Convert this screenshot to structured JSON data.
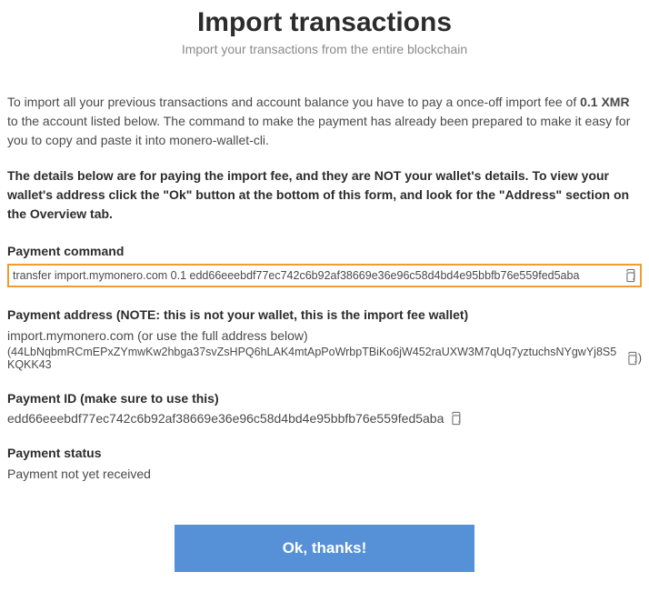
{
  "header": {
    "title": "Import transactions",
    "subtitle": "Import your transactions from the entire blockchain"
  },
  "intro": {
    "part1": "To import all your previous transactions and account balance you have to pay a once-off import fee of ",
    "fee": "0.1 XMR",
    "part2": " to the account listed below. The command to make the payment has already been prepared to make it easy for you to copy and paste it into monero-wallet-cli."
  },
  "warning": "The details below are for paying the import fee, and they are NOT your wallet's details. To view your wallet's address click the \"Ok\" button at the bottom of this form, and look for the \"Address\" section on the Overview tab.",
  "command": {
    "label": "Payment command",
    "value": "transfer import.mymonero.com 0.1 edd66eeebdf77ec742c6b92af38669e36e96c58d4bd4e95bbfb76e559fed5aba"
  },
  "address": {
    "label": "Payment address (NOTE: this is not your wallet, this is the import fee wallet)",
    "line1": "import.mymonero.com (or use the full address below)",
    "line2_prefix": "(",
    "line2_value": "44LbNqbmRCmEPxZYmwKw2hbga37svZsHPQ6hLAK4mtApPoWrbpTBiKo6jW452raUXW3M7qUq7yztuchsNYgwYj8S5KQKK43",
    "line2_suffix": ")"
  },
  "payment_id": {
    "label": "Payment ID (make sure to use this)",
    "value": "edd66eeebdf77ec742c6b92af38669e36e96c58d4bd4e95bbfb76e559fed5aba"
  },
  "status": {
    "label": "Payment status",
    "value": "Payment not yet received"
  },
  "button": {
    "ok": "Ok, thanks!"
  }
}
